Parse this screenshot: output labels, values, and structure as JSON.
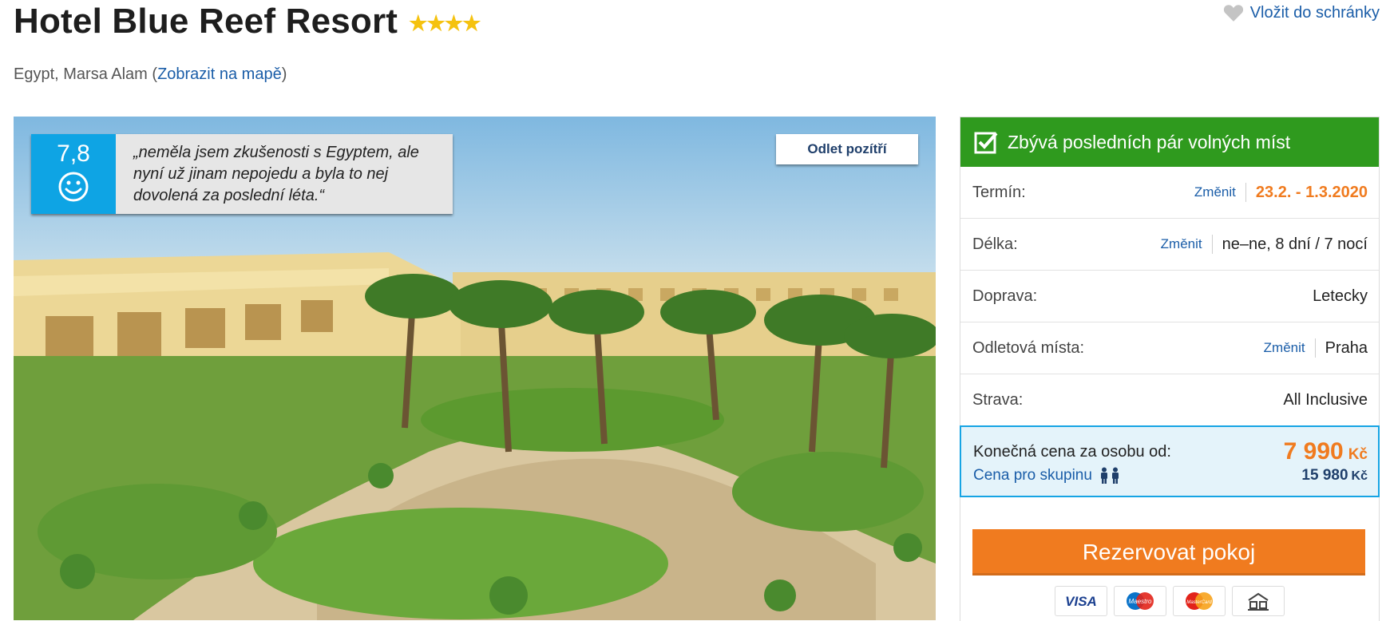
{
  "hotel": {
    "name": "Hotel Blue Reef Resort",
    "stars": "★★★★",
    "location_text": "Egypt, Marsa Alam",
    "map_link_label": "Zobrazit na mapě"
  },
  "wishlist": {
    "label": "Vložit do schránky"
  },
  "review": {
    "score": "7,8",
    "quote": "„neměla jsem zkušenosti s Egyptem, ale nyní už jinam nepojedu a byla to nej dovolená za poslední léta.“"
  },
  "photo": {
    "badge": "Odlet pozítří"
  },
  "booking": {
    "availability": "Zbývá posledních pár volných míst",
    "change_label": "Změnit",
    "rows": [
      {
        "label": "Termín:",
        "value": "23.2. - 1.3.2020"
      },
      {
        "label": "Délka:",
        "value": "ne–ne, 8 dní / 7 nocí"
      },
      {
        "label": "Doprava:",
        "value": "Letecky"
      },
      {
        "label": "Odletová místa:",
        "value": "Praha"
      },
      {
        "label": "Strava:",
        "value": "All Inclusive"
      }
    ],
    "price_label": "Konečná cena za osobu od:",
    "price_value": "7 990",
    "currency": "Kč",
    "group_label": "Cena pro skupinu",
    "group_value": "15 980",
    "reserve_label": "Rezervovat pokoj",
    "payment_methods": [
      "VISA",
      "Maestro",
      "MasterCard",
      "bank-transfer-icon"
    ]
  },
  "colors": {
    "availability_green": "#2f9a1e",
    "score_blue": "#0ea4e4",
    "accent_orange": "#f07b1f",
    "link_blue": "#1a5da8",
    "star_yellow": "#f5c20f"
  }
}
